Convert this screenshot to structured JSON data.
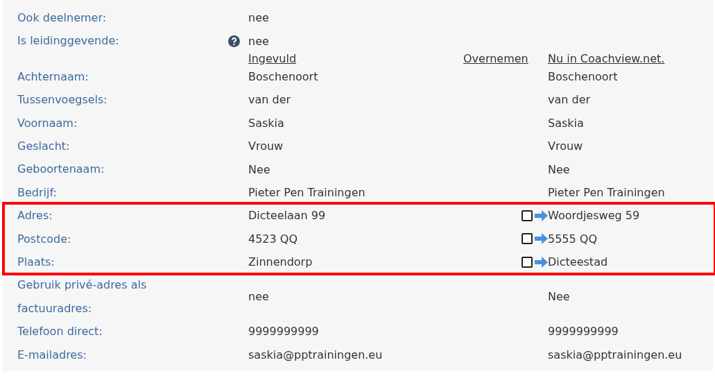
{
  "rows": [
    {
      "kind": "plain",
      "label": "Ook deelnemer:",
      "help": false,
      "value": "nee"
    },
    {
      "kind": "plain",
      "label": "Is leidinggevende:",
      "help": true,
      "value": "nee"
    },
    {
      "kind": "header",
      "columns": [
        "Ingevuld",
        "Overnemen",
        "Nu in Coachview.net."
      ]
    },
    {
      "kind": "compare",
      "label": "Achternaam:",
      "value": "Boschenoort",
      "current": "Boschenoort",
      "highlighted": false
    },
    {
      "kind": "compare",
      "label": "Tussenvoegsels:",
      "value": "van der",
      "current": "van der",
      "highlighted": false
    },
    {
      "kind": "compare",
      "label": "Voornaam:",
      "value": "Saskia",
      "current": "Saskia",
      "highlighted": false
    },
    {
      "kind": "compare",
      "label": "Geslacht:",
      "value": "Vrouw",
      "current": "Vrouw",
      "highlighted": false
    },
    {
      "kind": "compare",
      "label": "Geboortenaam:",
      "value": "Nee",
      "current": "Nee",
      "highlighted": false
    },
    {
      "kind": "compare",
      "label": "Bedrijf:",
      "value": "Pieter Pen Trainingen",
      "current": "Pieter Pen Trainingen",
      "highlighted": false
    },
    {
      "kind": "compare",
      "label": "Adres:",
      "value": "Dicteelaan 99",
      "current": "Woordjesweg 59",
      "copy": {
        "checked": false
      },
      "highlighted": true
    },
    {
      "kind": "compare",
      "label": "Postcode:",
      "value": "4523 QQ",
      "current": "5555 QQ",
      "copy": {
        "checked": false
      },
      "highlighted": true
    },
    {
      "kind": "compare",
      "label": "Plaats:",
      "value": "Zinnendorp",
      "current": "Dicteestad",
      "copy": {
        "checked": false
      },
      "highlighted": true
    },
    {
      "kind": "compare",
      "label": "Gebruik privé-adres als factuuradres:",
      "value": "nee",
      "current": "Nee",
      "highlighted": false
    },
    {
      "kind": "compare",
      "label": "Telefoon direct:",
      "value": "9999999999",
      "current": "9999999999",
      "highlighted": false
    },
    {
      "kind": "compare",
      "label": "E-mailadres:",
      "value": "saskia@pptrainingen.eu",
      "current": "saskia@pptrainingen.eu",
      "highlighted": false
    }
  ]
}
